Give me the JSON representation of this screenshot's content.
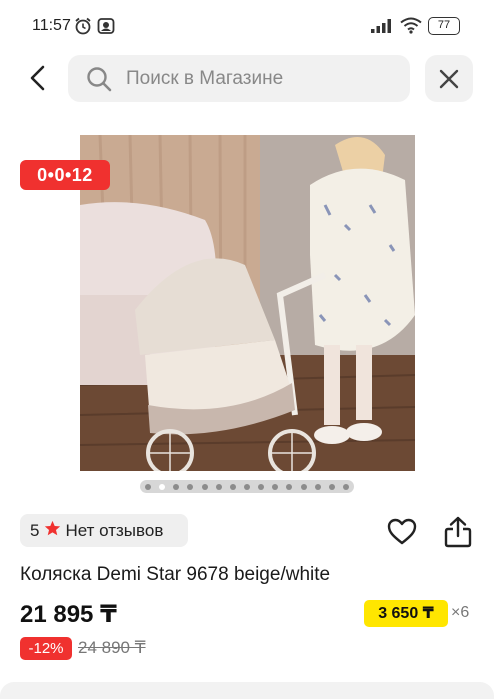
{
  "status_bar": {
    "time": "11:57",
    "battery": "77",
    "icons": [
      "alarm-icon",
      "notification-icon",
      "signal-icon",
      "wifi-icon",
      "battery-icon"
    ]
  },
  "header": {
    "search_placeholder": "Поиск в Магазине",
    "icons": [
      "back-arrow-icon",
      "search-icon",
      "close-icon"
    ]
  },
  "gallery": {
    "timer": "0•0•12",
    "dot_count": 15,
    "active_dot": 1,
    "colors": {
      "timer_bg": "#f0312f",
      "dots_bg": "#d7d7d7"
    }
  },
  "rating": {
    "score": "5",
    "reviews": "Нет отзывов",
    "star_color": "#f0312f"
  },
  "actions": {
    "icons": [
      "heart-icon",
      "share-icon"
    ]
  },
  "product": {
    "title": "Коляска Demi Star 9678 beige/white",
    "price": "21 895 ₸",
    "installment_price": "3 650 ₸",
    "installment_times": "×6",
    "discount": "-12%",
    "old_price": "24 890 ₸",
    "colors": {
      "installment_bg": "#ffe600",
      "discount_bg": "#f0312f"
    }
  }
}
